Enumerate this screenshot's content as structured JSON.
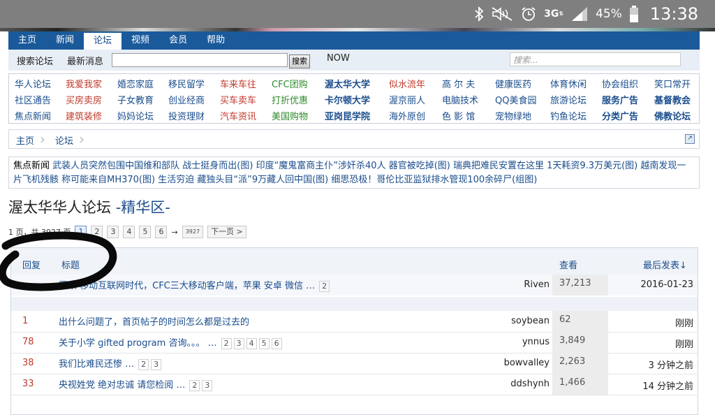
{
  "status_bar": {
    "icons": [
      "bluetooth-icon",
      "mute-icon",
      "alarm-icon",
      "network-3g-icon",
      "signal-icon",
      "battery-icon"
    ],
    "network": "3G",
    "battery": "45%",
    "time": "13:38"
  },
  "nav": {
    "tabs": [
      {
        "label": "主页",
        "active": false
      },
      {
        "label": "新闻",
        "active": false
      },
      {
        "label": "论坛",
        "active": true
      },
      {
        "label": "视频",
        "active": false
      },
      {
        "label": "会员",
        "active": false
      },
      {
        "label": "帮助",
        "active": false
      }
    ]
  },
  "search": {
    "label_forum": "搜索论坛",
    "label_latest": "最新消息",
    "button": "搜索",
    "now_label": "NOW",
    "placeholder2": "搜索..."
  },
  "categories": [
    [
      {
        "label": "华人论坛",
        "color": "#1a4d8c",
        "bold": false
      },
      {
        "label": "我爱我家",
        "color": "#c0392b",
        "bold": false
      },
      {
        "label": "婚恋家庭",
        "color": "#1a4d8c",
        "bold": false
      },
      {
        "label": "移民留学",
        "color": "#1a4d8c",
        "bold": false
      },
      {
        "label": "车来车往",
        "color": "#c0392b",
        "bold": false
      },
      {
        "label": "CFC团购",
        "color": "#2e8b2e",
        "bold": false
      },
      {
        "label": "渥太华大学",
        "color": "#1a4d8c",
        "bold": true
      },
      {
        "label": "似水流年",
        "color": "#c0392b",
        "bold": false
      },
      {
        "label": "高 尔 夫",
        "color": "#1a4d8c",
        "bold": false
      },
      {
        "label": "健康医药",
        "color": "#1a4d8c",
        "bold": false
      },
      {
        "label": "体育休闲",
        "color": "#1a4d8c",
        "bold": false
      },
      {
        "label": "协会组织",
        "color": "#1a4d8c",
        "bold": false
      },
      {
        "label": "笑口常开",
        "color": "#1a4d8c",
        "bold": false
      }
    ],
    [
      {
        "label": "社区通告",
        "color": "#1a4d8c",
        "bold": false
      },
      {
        "label": "买房卖房",
        "color": "#c0392b",
        "bold": false
      },
      {
        "label": "子女教育",
        "color": "#1a4d8c",
        "bold": false
      },
      {
        "label": "创业经商",
        "color": "#1a4d8c",
        "bold": false
      },
      {
        "label": "买车卖车",
        "color": "#c0392b",
        "bold": false
      },
      {
        "label": "打折优惠",
        "color": "#2e8b2e",
        "bold": false
      },
      {
        "label": "卡尔顿大学",
        "color": "#1a4d8c",
        "bold": true
      },
      {
        "label": "渥京丽人",
        "color": "#1a4d8c",
        "bold": false
      },
      {
        "label": "电脑技术",
        "color": "#1a4d8c",
        "bold": false
      },
      {
        "label": "QQ美食园",
        "color": "#1a4d8c",
        "bold": false
      },
      {
        "label": "旅游论坛",
        "color": "#1a4d8c",
        "bold": false
      },
      {
        "label": "服务广告",
        "color": "#1a4d8c",
        "bold": true
      },
      {
        "label": "基督教会",
        "color": "#1a4d8c",
        "bold": true
      }
    ],
    [
      {
        "label": "焦点新闻",
        "color": "#1a4d8c",
        "bold": false
      },
      {
        "label": "建筑装修",
        "color": "#c0392b",
        "bold": false
      },
      {
        "label": "妈妈论坛",
        "color": "#1a4d8c",
        "bold": false
      },
      {
        "label": "投资理财",
        "color": "#1a4d8c",
        "bold": false
      },
      {
        "label": "汽车资讯",
        "color": "#c0392b",
        "bold": false
      },
      {
        "label": "美国购物",
        "color": "#2e8b2e",
        "bold": false
      },
      {
        "label": "亚岗昆学院",
        "color": "#1a4d8c",
        "bold": true
      },
      {
        "label": "海外原创",
        "color": "#1a4d8c",
        "bold": false
      },
      {
        "label": "色 影 馆",
        "color": "#1a4d8c",
        "bold": false
      },
      {
        "label": "宠物绿地",
        "color": "#1a4d8c",
        "bold": false
      },
      {
        "label": "钓鱼论坛",
        "color": "#1a4d8c",
        "bold": false
      },
      {
        "label": "分类广告",
        "color": "#1a4d8c",
        "bold": true
      },
      {
        "label": "佛教论坛",
        "color": "#1a4d8c",
        "bold": true
      }
    ]
  ],
  "breadcrumb": [
    "主页",
    "论坛"
  ],
  "focus_news": {
    "label": "焦点新闻",
    "text": "武装人员突然包围中国维和部队 战士挺身而出(图) 印度“魔鬼富商主仆”涉奸杀40人 器官被吃掉(图) 瑞典把难民安置在这里 1天耗资9.3万美元(图) 越南发现一片飞机残骸 称可能来自MH370(图) 生活穷迫 藏独头目“派”9万藏人回中国(图) 细思恐极！哥伦比亚监狱排水管现100余碎尸(组图)"
  },
  "page_title": {
    "main": "渥太华华人论坛 ",
    "sub": "-精华区-"
  },
  "pager": {
    "prefix": "1 页，共 3927 页",
    "pages": [
      "1",
      "2",
      "3",
      "4",
      "5",
      "6"
    ],
    "arrow": "→",
    "last": "3927",
    "next": "下一页 >"
  },
  "table": {
    "headers": {
      "replies": "回复",
      "title": "标题",
      "views": "查看",
      "last_post": "最后发表↓"
    },
    "pinned": {
      "title": "置顶 移动互联网时代，CFC三大移动客户端，苹果 安卓 微信 …",
      "pages": [
        "2"
      ],
      "author": "Riven",
      "views": "37,213",
      "date": "2016-01-23"
    },
    "rows": [
      {
        "replies": "1",
        "title": "出什么问题了，首页帖子的时间怎么都是过去的",
        "pages": [],
        "author": "soybean",
        "views": "62",
        "date": "刚刚"
      },
      {
        "replies": "78",
        "title": "关于小学 gifted program 咨询。。。 …",
        "pages": [
          "2",
          "3",
          "4",
          "5",
          "6"
        ],
        "author": "ynnus",
        "views": "3,849",
        "date": "刚刚"
      },
      {
        "replies": "38",
        "title": "我们比难民还惨 …",
        "pages": [
          "2",
          "3"
        ],
        "author": "bowvalley",
        "views": "2,263",
        "date": "3 分钟之前"
      },
      {
        "replies": "33",
        "title": "央视姓党 绝对忠诚 请您检阅 …",
        "pages": [
          "2",
          "3"
        ],
        "author": "ddshynh",
        "views": "1,466",
        "date": "14 分钟之前"
      }
    ]
  }
}
